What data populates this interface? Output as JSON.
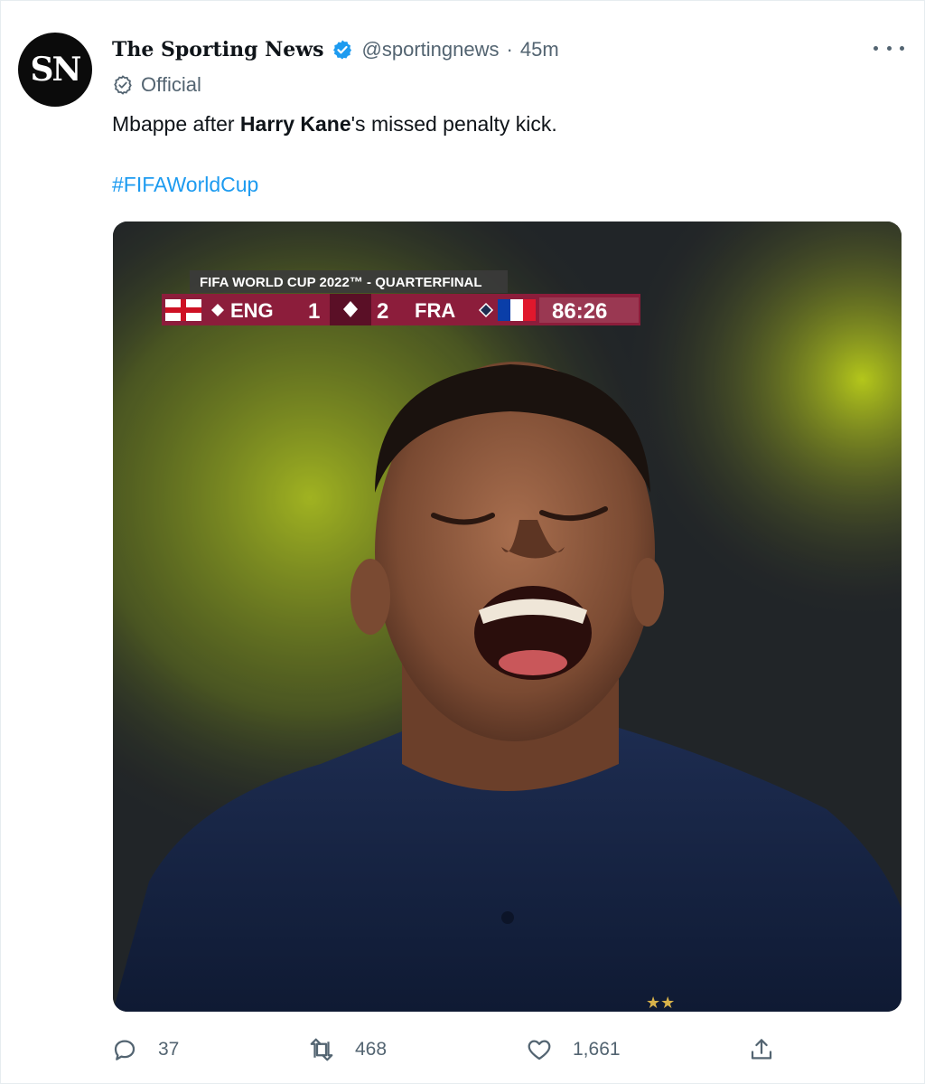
{
  "tweet": {
    "author_name": "The Sporting News",
    "avatar_text": "SN",
    "handle": "@sportingnews",
    "separator": "·",
    "time": "45m",
    "label": "Official",
    "text_part1": "Mbappe after ",
    "text_bold": "Harry Kane",
    "text_part2": "'s missed penalty kick.",
    "hashtag": "#FIFAWorldCup"
  },
  "media": {
    "banner": "FIFA WORLD CUP 2022™ - QUARTERFINAL",
    "team_home": "ENG",
    "score_home": "1",
    "score_away": "2",
    "team_away": "FRA",
    "clock": "86:26"
  },
  "actions": {
    "reply_count": "37",
    "retweet_count": "468",
    "like_count": "1,661"
  },
  "colors": {
    "accent": "#1d9bf0",
    "scoreboard": "#8c1d3b"
  }
}
